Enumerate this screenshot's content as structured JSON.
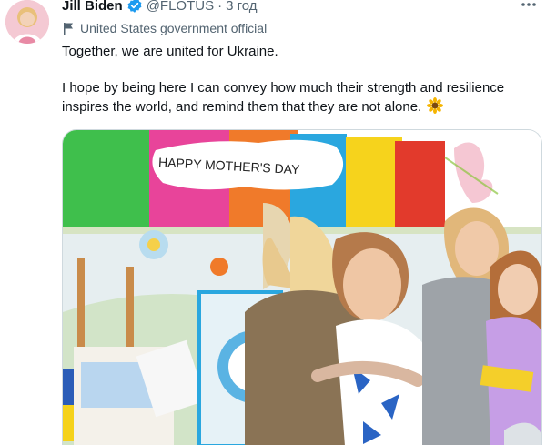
{
  "tweet": {
    "author_name": "Jill Biden",
    "handle": "@FLOTUS",
    "separator": "·",
    "time": "3 год",
    "label": "United States government official",
    "paragraphs": [
      "Together, we are united for Ukraine.",
      "I hope by being here I can convey how much their strength and resilience inspires the world, and remind them that they are not alone."
    ],
    "emoji_icon": "sunflower-icon",
    "more_icon": "more-icon"
  },
  "media": {
    "banner_text": "HAPPY MOTHER'S DAY"
  },
  "colors": {
    "verified": "#1d9bf0",
    "secondary_text": "#536471",
    "banner_stripes": [
      "#3fbf4c",
      "#e8449a",
      "#f07a2a",
      "#2aa7df",
      "#f6d31c",
      "#e23a2c"
    ]
  }
}
